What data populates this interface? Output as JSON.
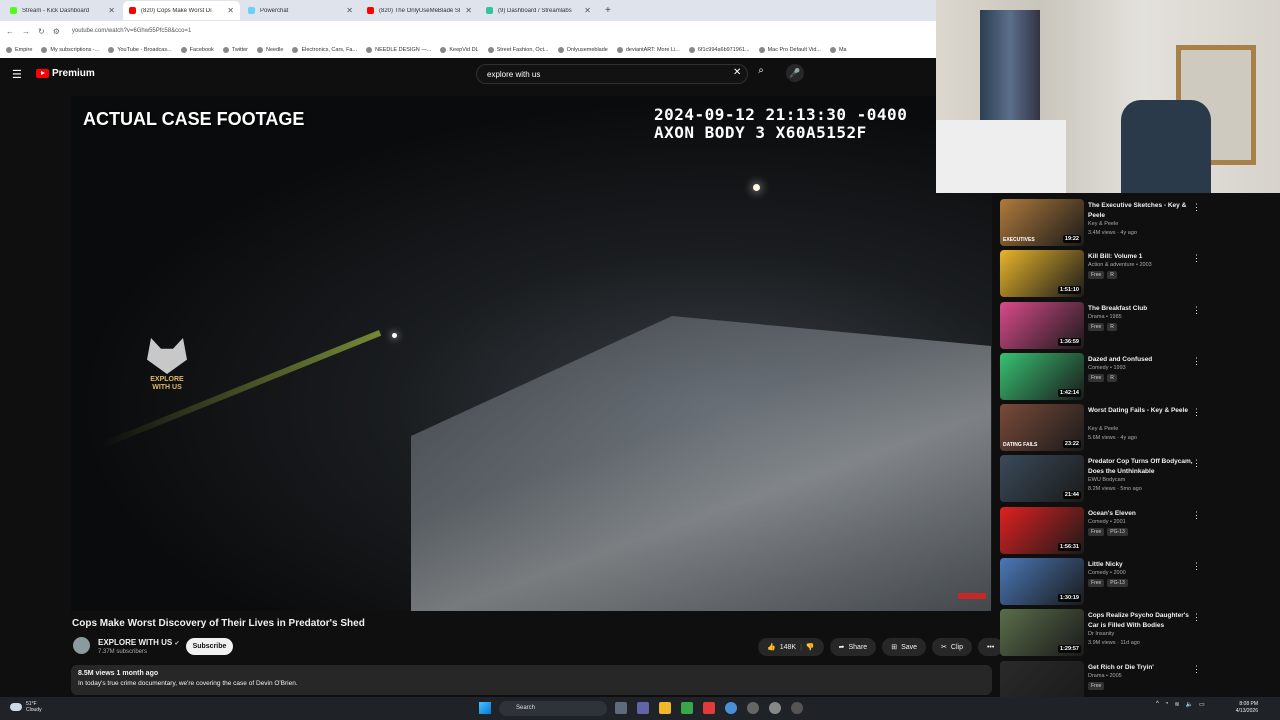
{
  "browser": {
    "tabs": [
      {
        "title": "Stream - Kick Dashboard",
        "color": "#53fc18",
        "active": false
      },
      {
        "title": "(820) Cops Make Worst Di",
        "color": "#ff0000",
        "active": true
      },
      {
        "title": "Powerchat",
        "color": "#6ad1ff",
        "active": false
      },
      {
        "title": "(820) The OnlyUseMeBlade She",
        "color": "#ff0000",
        "active": false
      },
      {
        "title": "(9) Dashboard / Streamlabs",
        "color": "#31c3a2",
        "active": false
      }
    ],
    "new_tab": "+",
    "url": "youtube.com/watch?v=6Ghw55Pfc58&cco=1",
    "bookmarks": [
      "Empire",
      "My subscriptions -...",
      "YouTube - Broadcas...",
      "Facebook",
      "Twitter",
      "Needle",
      "Electronics, Cars, Fa...",
      "NEEDLE DESIGN —...",
      "KeepVid DL",
      "Street Fashion, Oct...",
      "Onlyusemeblade",
      "deviantART: More Li...",
      "6f1c994a6b971961...",
      "Mac Pro Default Vid...",
      "Ma"
    ]
  },
  "youtube": {
    "logo_label": "Premium",
    "search_value": "explore with us",
    "video": {
      "overlay_title": "ACTUAL CASE FOOTAGE",
      "timestamp": "2024-09-12 21:13:30 -0400",
      "camera": "AXON BODY 3 X60A5152F",
      "watermark_text": "EXPLORE WITH US"
    },
    "title": "Cops Make Worst Discovery of Their Lives in Predator's Shed",
    "channel": {
      "name": "EXPLORE WITH US",
      "subscribers": "7.37M subscribers",
      "subscribe_label": "Subscribe"
    },
    "actions": {
      "likes": "148K",
      "share": "Share",
      "save": "Save",
      "clip": "Clip",
      "more": "•••"
    },
    "description": {
      "stats": "8.5M views  1 month ago",
      "text": "In today's true crime documentary, we're covering the case of Devin O'Brien."
    }
  },
  "recommendations": [
    {
      "title": "The Executive Sketches - Key & Peele",
      "channel": "Key & Peele",
      "meta": "3.4M views · 4y ago",
      "duration": "19:22",
      "thumb_label": "EXECUTIVES",
      "thumb_color": "#b07a3c",
      "free": false
    },
    {
      "title": "Kill Bill: Volume 1",
      "channel": "Action & adventure • 2003",
      "meta": "",
      "duration": "1:51:10",
      "thumb_label": "",
      "thumb_color": "#e8b42a",
      "free": true,
      "rating": "R"
    },
    {
      "title": "The Breakfast Club",
      "channel": "Drama • 1985",
      "meta": "",
      "duration": "1:36:59",
      "thumb_label": "",
      "thumb_color": "#d94a8a",
      "free": true,
      "rating": "R"
    },
    {
      "title": "Dazed and Confused",
      "channel": "Comedy • 1993",
      "meta": "",
      "duration": "1:42:14",
      "thumb_label": "",
      "thumb_color": "#38c172",
      "free": true,
      "rating": "R"
    },
    {
      "title": "Worst Dating Fails - Key & Peele",
      "channel": "Key & Peele",
      "meta": "5.6M views · 4y ago",
      "duration": "23:22",
      "thumb_label": "DATING FAILS",
      "thumb_color": "#7a4a3a",
      "free": false
    },
    {
      "title": "Predator Cop Turns Off Bodycam, Does the Unthinkable",
      "channel": "EWU Bodycam",
      "meta": "8.2M views · 5mo ago",
      "duration": "21:44",
      "thumb_label": "",
      "thumb_color": "#3a4a5a",
      "free": false
    },
    {
      "title": "Ocean's Eleven",
      "channel": "Comedy • 2001",
      "meta": "",
      "duration": "1:56:31",
      "thumb_label": "",
      "thumb_color": "#e02020",
      "free": true,
      "rating": "PG-13"
    },
    {
      "title": "Little Nicky",
      "channel": "Comedy • 2000",
      "meta": "",
      "duration": "1:30:19",
      "thumb_label": "",
      "thumb_color": "#4a78b8",
      "free": true,
      "rating": "PG-13"
    },
    {
      "title": "Cops Realize Psycho Daughter's Car is Filled With Bodies",
      "channel": "Dr Insanity",
      "meta": "3.9M views · 11d ago",
      "duration": "1:29:57",
      "thumb_label": "",
      "thumb_color": "#5a6e4a",
      "free": false
    },
    {
      "title": "Get Rich or Die Tryin'",
      "channel": "Drama • 2005",
      "meta": "",
      "duration": "",
      "thumb_label": "",
      "thumb_color": "#2a2a2a",
      "free": true,
      "rating": ""
    }
  ],
  "taskbar": {
    "temperature": "51°F",
    "weather": "Cloudy",
    "search_placeholder": "Search",
    "time": "8:08 PM",
    "date": "4/13/2026"
  }
}
